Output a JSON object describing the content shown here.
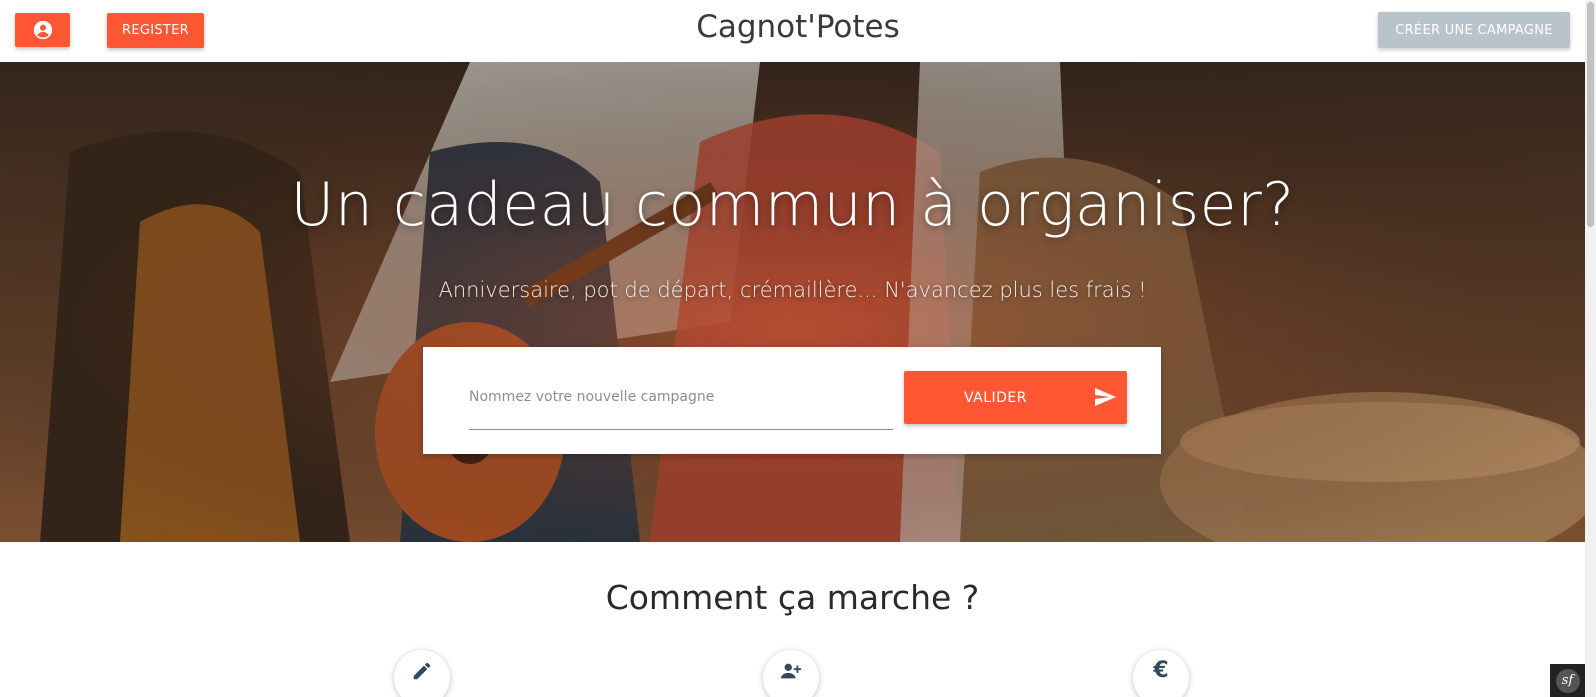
{
  "header": {
    "account_icon": "account-circle-icon",
    "register_label": "REGISTER",
    "brand": "Cagnot'Potes",
    "create_campaign_label": "CRÉER UNE CAMPAGNE"
  },
  "hero": {
    "title": "Un cadeau commun à organiser?",
    "subtitle": "Anniversaire, pot de départ, crémaillère... N'avancez plus les frais !",
    "input_placeholder": "Nommez votre nouvelle campagne",
    "input_value": "",
    "validate_label": "VALIDER",
    "validate_icon": "send-icon"
  },
  "how_it_works": {
    "title": "Comment ça marche ?",
    "steps": [
      {
        "icon": "pencil-icon"
      },
      {
        "icon": "add-user-icon"
      },
      {
        "icon": "euro-icon",
        "glyph": "€"
      }
    ]
  },
  "debug_toolbar": {
    "icon": "symfony-icon",
    "glyph": "sf"
  },
  "colors": {
    "accent": "#ff5733",
    "disabled_button": "#b9c3cb",
    "text_dark": "#2a2a2a",
    "icon_dark": "#34495e"
  }
}
